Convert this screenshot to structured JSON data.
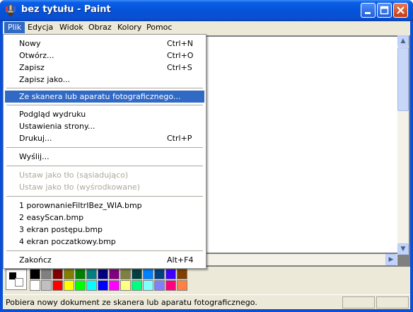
{
  "window": {
    "title": "bez tytułu - Paint"
  },
  "menubar": {
    "items": [
      "Plik",
      "Edycja",
      "Widok",
      "Obraz",
      "Kolory",
      "Pomoc"
    ]
  },
  "file_menu": {
    "new": {
      "label": "Nowy",
      "shortcut": "Ctrl+N"
    },
    "open": {
      "label": "Otwórz...",
      "shortcut": "Ctrl+O"
    },
    "save": {
      "label": "Zapisz",
      "shortcut": "Ctrl+S"
    },
    "save_as": {
      "label": "Zapisz jako..."
    },
    "from_scanner": {
      "label": "Ze skanera lub aparatu fotograficznego..."
    },
    "print_preview": {
      "label": "Podgląd wydruku"
    },
    "page_setup": {
      "label": "Ustawienia strony..."
    },
    "print": {
      "label": "Drukuj...",
      "shortcut": "Ctrl+P"
    },
    "send": {
      "label": "Wyślij..."
    },
    "set_bg_tiled": {
      "label": "Ustaw jako tło (sąsiadująco)"
    },
    "set_bg_centered": {
      "label": "Ustaw jako tło (wyśrodkowane)"
    },
    "recent": [
      "1 porownanieFiltrIBez_WIA.bmp",
      "2 easyScan.bmp",
      "3 ekran postępu.bmp",
      "4 ekran poczatkowy.bmp"
    ],
    "exit": {
      "label": "Zakończ",
      "shortcut": "Alt+F4"
    }
  },
  "palette": {
    "top_row": [
      "#000000",
      "#808080",
      "#800000",
      "#808000",
      "#008000",
      "#008080",
      "#000080",
      "#800080",
      "#808040",
      "#004040",
      "#0080ff",
      "#004080",
      "#4000ff",
      "#804000"
    ],
    "bottom_row": [
      "#ffffff",
      "#c0c0c0",
      "#ff0000",
      "#ffff00",
      "#00ff00",
      "#00ffff",
      "#0000ff",
      "#ff00ff",
      "#ffff80",
      "#00ff80",
      "#80ffff",
      "#8080ff",
      "#ff0080",
      "#ff8040"
    ]
  },
  "statusbar": {
    "text": "Pobiera nowy dokument ze skanera lub aparatu fotograficznego."
  },
  "icons": {
    "app": "paint-brush-icon",
    "minimize": "minimize-icon",
    "maximize": "maximize-icon",
    "close": "close-icon"
  }
}
